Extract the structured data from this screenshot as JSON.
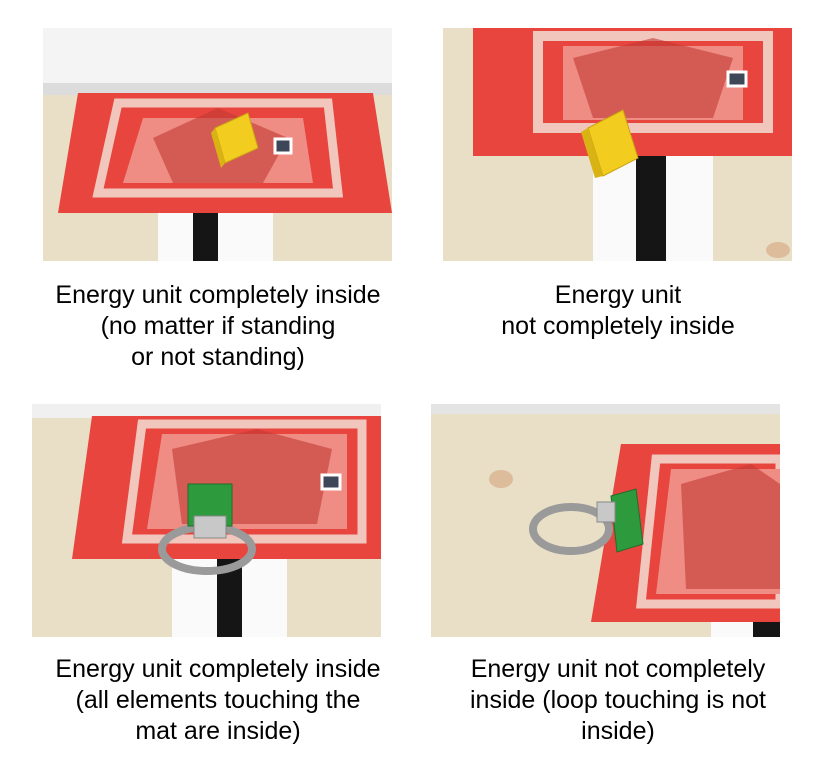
{
  "panels": [
    {
      "image": "yellow-energy-unit-completely-inside-photo",
      "caption": [
        "Energy unit completely inside",
        "(no matter if standing",
        "or not standing)"
      ]
    },
    {
      "image": "yellow-energy-unit-not-completely-inside-photo",
      "caption": [
        "Energy unit",
        "not completely inside"
      ]
    },
    {
      "image": "green-energy-unit-completely-inside-photo",
      "caption": [
        "Energy unit completely inside",
        "(all elements touching the",
        "mat are inside)"
      ]
    },
    {
      "image": "green-energy-unit-not-completely-inside-photo",
      "caption": [
        "Energy unit not completely",
        "inside (loop touching is not",
        "inside)"
      ]
    }
  ],
  "colors": {
    "mat_red": "#e8453f",
    "mat_pink": "#ef8c84",
    "mat_dark": "#c23a34",
    "table_beige": "#e9dfc7",
    "yellow_brick": "#f2cd1f",
    "green_brick": "#2e9a3e",
    "grey_loop": "#9a9a9a"
  }
}
